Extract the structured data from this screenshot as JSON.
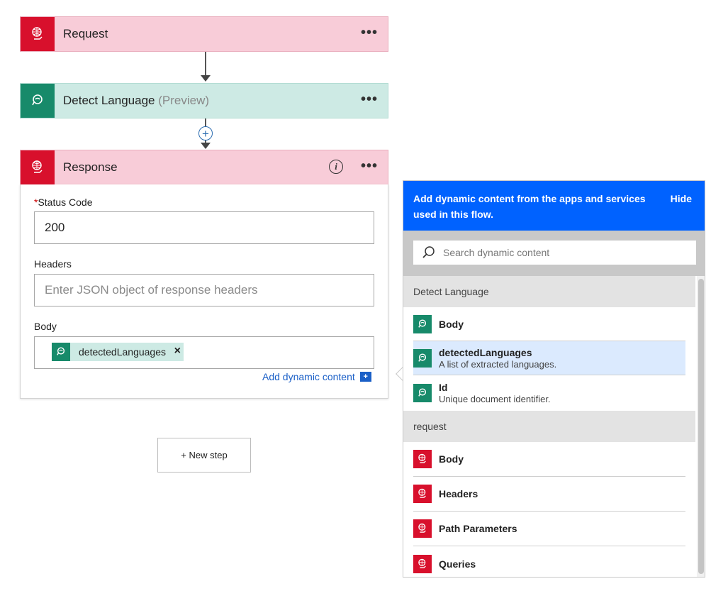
{
  "flow": {
    "request": {
      "title": "Request",
      "more": "•••"
    },
    "detect": {
      "title": "Detect Language",
      "suffix": "(Preview)",
      "more": "•••"
    },
    "insert_step": "+",
    "response": {
      "title": "Response",
      "info": "i",
      "more": "•••",
      "status_label": "Status Code",
      "required_mark": "*",
      "status_value": "200",
      "headers_label": "Headers",
      "headers_placeholder": "Enter JSON object of response headers",
      "body_label": "Body",
      "body_token": "detectedLanguages",
      "token_remove": "×",
      "add_dynamic": "Add dynamic content",
      "add_dynamic_icon": "+"
    },
    "new_step": "+ New step"
  },
  "dynamic_panel": {
    "message": "Add dynamic content from the apps and services used in this flow.",
    "hide": "Hide",
    "search_placeholder": "Search dynamic content",
    "groups": [
      {
        "name": "Detect Language",
        "items": [
          {
            "name": "Body",
            "desc": ""
          },
          {
            "name": "detectedLanguages",
            "desc": "A list of extracted languages."
          },
          {
            "name": "Id",
            "desc": "Unique document identifier."
          }
        ]
      },
      {
        "name": "request",
        "items": [
          {
            "name": "Body"
          },
          {
            "name": "Headers"
          },
          {
            "name": "Path Parameters"
          },
          {
            "name": "Queries"
          }
        ]
      }
    ]
  },
  "icons": {
    "request": "globe-hand-icon",
    "detect": "text-analytics-icon",
    "search": "search-icon"
  },
  "colors": {
    "request_accent": "#d8102c",
    "request_header_bg": "#f8ccd8",
    "detect_accent": "#178a6a",
    "detect_header_bg": "#cdeae4",
    "panel_header": "#0062ff",
    "link": "#1a5fc7"
  }
}
